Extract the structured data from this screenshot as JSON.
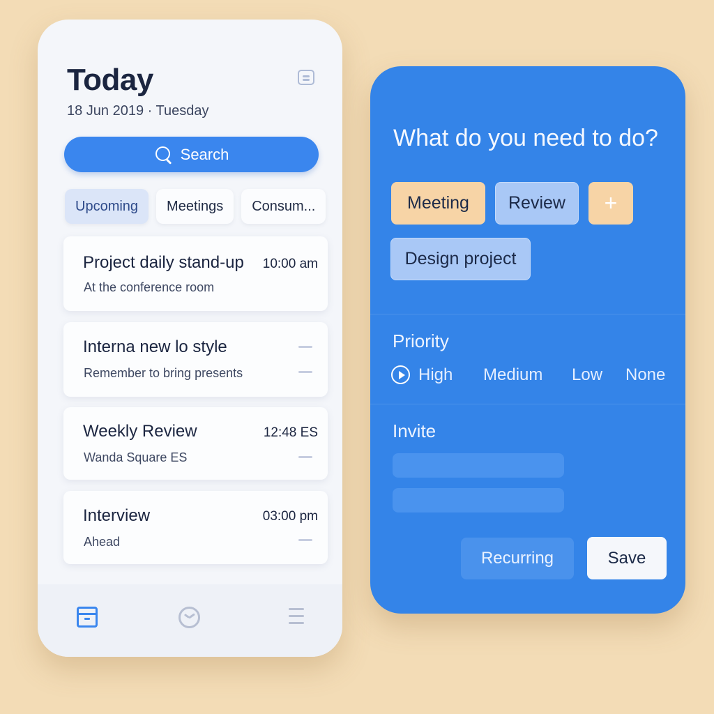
{
  "phone": {
    "title": "Today",
    "date": "18 Jun 2019 · Tuesday",
    "search_label": "Search",
    "tabs": [
      {
        "label": "Upcoming"
      },
      {
        "label": "Meetings"
      },
      {
        "label": "Consum..."
      }
    ],
    "active_tab": "Upcoming",
    "events": [
      {
        "title": "Project daily stand-up",
        "subtitle": "At the conference room",
        "time": "10:00 am"
      },
      {
        "title": "Interna new lo style",
        "subtitle": "Remember to bring presents",
        "time": ""
      },
      {
        "title": "Weekly Review",
        "subtitle": "Wanda Square ES",
        "time": "12:48 ES"
      },
      {
        "title": "Interview",
        "subtitle": "Ahead",
        "time": "03:00 pm"
      }
    ],
    "bottom_nav": [
      "inbox-icon",
      "clock-icon",
      "list-icon"
    ],
    "active_nav": "inbox-icon"
  },
  "panel": {
    "title": "What do you need to do?",
    "chips": [
      {
        "label": "Meeting",
        "color": "#f7d4a6"
      },
      {
        "label": "Review",
        "color": "#a9c8f6"
      },
      {
        "label": "+",
        "color": "#f7d4a6"
      },
      {
        "label": "Design project",
        "color": "#a9c8f6"
      }
    ],
    "priority_label": "Priority",
    "priority_options": [
      "High",
      "Medium",
      "Low",
      "None"
    ],
    "priority_selected": "High",
    "invite_label": "Invite",
    "recurring_label": "Recurring",
    "save_label": "Save"
  },
  "colors": {
    "background": "#f3dcb6",
    "accent": "#3a86ee",
    "panel": "#3484e8",
    "peach": "#f7d4a6",
    "light_blue": "#a9c8f6"
  }
}
